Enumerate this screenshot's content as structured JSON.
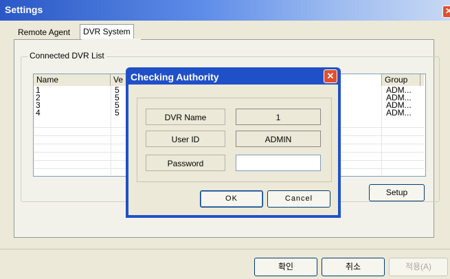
{
  "window": {
    "title": "Settings"
  },
  "tabs": [
    {
      "label": "Remote Agent"
    },
    {
      "label": "DVR System"
    }
  ],
  "connected_list": {
    "group_label": "Connected DVR List",
    "columns": {
      "name": "Name",
      "version_partial": "Ve",
      "group": "Group"
    },
    "rows": [
      {
        "name": "1",
        "version": "5",
        "group": "ADM..."
      },
      {
        "name": "2",
        "version": "5",
        "group": "ADM..."
      },
      {
        "name": "3",
        "version": "5",
        "group": "ADM..."
      },
      {
        "name": "4",
        "version": "5",
        "group": "ADM..."
      }
    ],
    "setup_label": "Setup"
  },
  "footer": {
    "ok_label": "확인",
    "cancel_label": "취소",
    "apply_label": "적용(A)"
  },
  "dialog": {
    "title": "Checking Authority",
    "fields": {
      "dvr_name_label": "DVR Name",
      "dvr_name_value": "1",
      "user_id_label": "User ID",
      "user_id_value": "ADMIN",
      "password_label": "Password",
      "password_value": ""
    },
    "ok_label": "OK",
    "cancel_label": "Cancel"
  },
  "icons": {
    "close": "close-icon"
  }
}
